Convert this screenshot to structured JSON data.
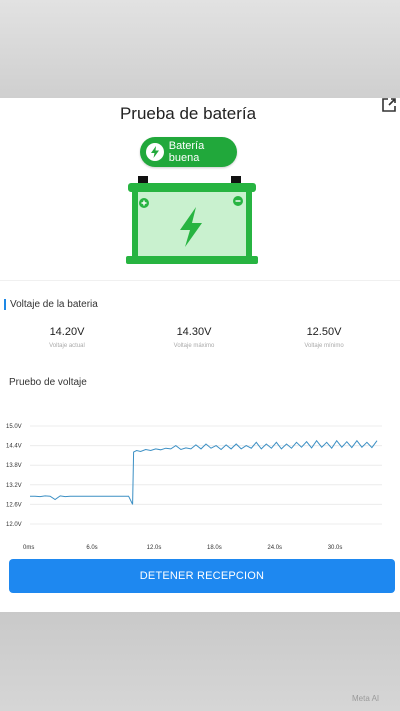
{
  "header": {
    "title": "Prueba de batería"
  },
  "status_badge": {
    "label": "Batería buena"
  },
  "voltage_section": {
    "title": "Voltaje de la bateria",
    "stats": [
      {
        "value": "14.20V",
        "label": "Voltaje actual"
      },
      {
        "value": "14.30V",
        "label": "Voltaje máximo"
      },
      {
        "value": "12.50V",
        "label": "Voltaje mínimo"
      }
    ]
  },
  "chart_section": {
    "title": "Pruebo de voltaje"
  },
  "chart_data": {
    "type": "line",
    "x_ticks": [
      "0ms",
      "6.0s",
      "12.0s",
      "18.0s",
      "24.0s",
      "30.0s"
    ],
    "x_tick_values": [
      0,
      6,
      12,
      18,
      24,
      30
    ],
    "y_ticks": [
      "15.0V",
      "14.4V",
      "13.8V",
      "13.2V",
      "12.6V",
      "12.0V"
    ],
    "y_tick_values": [
      15.0,
      14.4,
      13.8,
      13.2,
      12.6,
      12.0
    ],
    "ylim": [
      12.0,
      15.0
    ],
    "xlim": [
      0,
      35
    ],
    "grid": true,
    "series": [
      {
        "x": [
          0,
          0.5,
          1,
          1.5,
          2,
          2.5,
          3,
          3.5,
          4,
          5,
          6,
          7,
          8,
          9,
          9.8,
          10.2,
          10.3,
          10.6,
          11,
          11.5,
          12,
          12.5,
          13,
          13.5,
          14,
          14.5,
          15,
          15.5,
          16,
          16.5,
          17,
          17.5,
          18,
          18.5,
          19,
          19.5,
          20,
          20.5,
          21,
          21.5,
          22,
          22.5,
          23,
          23.5,
          24,
          24.5,
          25,
          25.5,
          26,
          26.5,
          27,
          27.5,
          28,
          28.5,
          29,
          29.5,
          30,
          30.5,
          31,
          31.5,
          32,
          32.5,
          33,
          33.5,
          34,
          34.5
        ],
        "y": [
          12.85,
          12.85,
          12.84,
          12.86,
          12.85,
          12.75,
          12.86,
          12.84,
          12.85,
          12.85,
          12.85,
          12.85,
          12.85,
          12.85,
          12.85,
          12.6,
          14.2,
          14.25,
          14.22,
          14.28,
          14.25,
          14.3,
          14.27,
          14.32,
          14.3,
          14.4,
          14.28,
          14.33,
          14.3,
          14.42,
          14.3,
          14.45,
          14.32,
          14.4,
          14.28,
          14.42,
          14.3,
          14.45,
          14.3,
          14.4,
          14.32,
          14.5,
          14.3,
          14.45,
          14.32,
          14.5,
          14.3,
          14.45,
          14.32,
          14.5,
          14.35,
          14.52,
          14.33,
          14.55,
          14.35,
          14.5,
          14.32,
          14.55,
          14.35,
          14.52,
          14.34,
          14.55,
          14.35,
          14.5,
          14.34,
          14.55
        ]
      }
    ]
  },
  "actions": {
    "stop_label": "DETENER RECEPCION"
  },
  "watermark": {
    "label": "Meta AI"
  },
  "colors": {
    "accent": "#1e88f0",
    "good": "#21a83b",
    "line": "#3b8fc4"
  }
}
